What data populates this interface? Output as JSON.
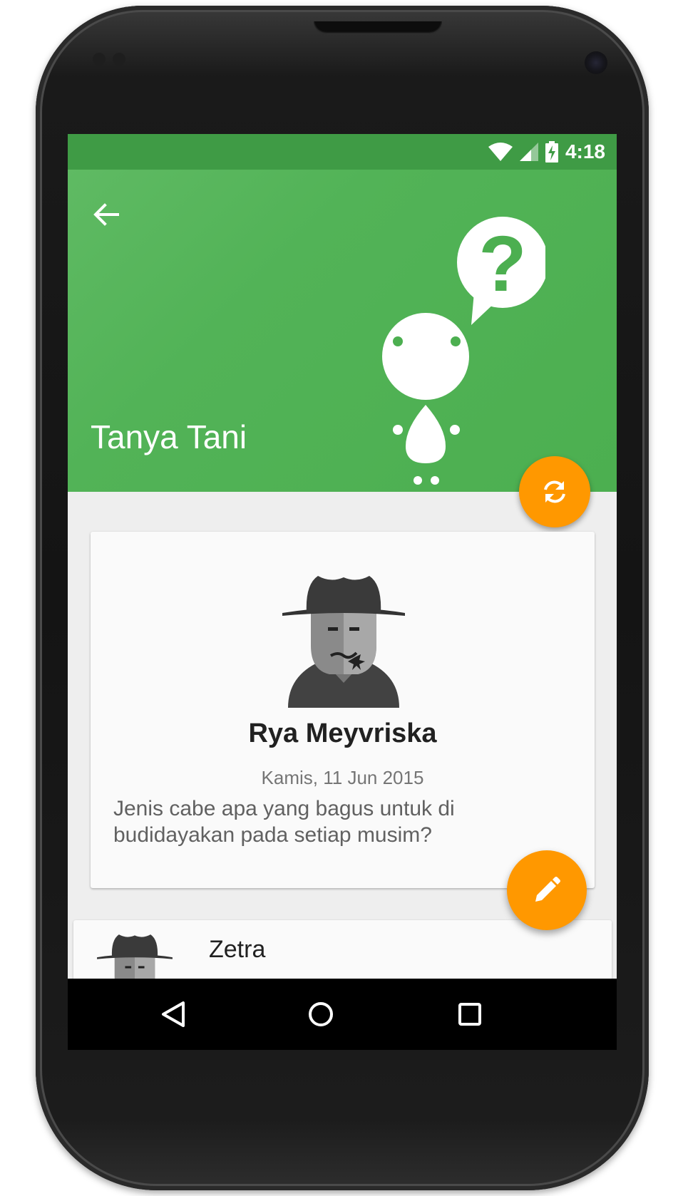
{
  "status_bar": {
    "time": "4:18",
    "icons": [
      "wifi-icon",
      "signal-icon",
      "battery-charging-icon"
    ]
  },
  "app_bar": {
    "title": "Tanya Tani",
    "back_icon": "arrow-back-icon",
    "illustration": "mascot-question-icon"
  },
  "fab_refresh": {
    "icon": "refresh-icon"
  },
  "fab_edit": {
    "icon": "pencil-icon"
  },
  "posts": [
    {
      "author": "Rya Meyvriska",
      "date": "Kamis, 11 Jun 2015",
      "question": "Jenis cabe apa yang bagus untuk di budidayakan pada setiap musim?",
      "avatar": "farmer-avatar-icon"
    },
    {
      "author": "Zetra",
      "preview": "...",
      "avatar": "farmer-avatar-icon"
    }
  ],
  "nav_bar": {
    "icons": [
      "back-triangle-icon",
      "home-circle-icon",
      "recents-square-icon"
    ]
  },
  "colors": {
    "primary": "#4caf50",
    "primary_dark": "#3f9b45",
    "accent": "#ff9800",
    "card": "#fafafa",
    "background": "#eeeeee"
  }
}
